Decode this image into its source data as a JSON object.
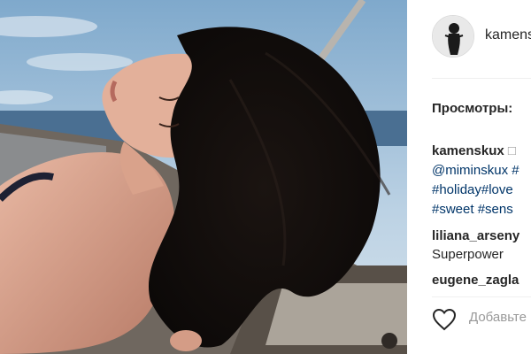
{
  "post": {
    "username": "kamenskux",
    "views_label": "Просмотры:",
    "caption": {
      "username": "kamenskux",
      "box_glyph": "□",
      "lines": [
        "@miminskux #",
        "#holiday#love",
        "#sweet #sens"
      ]
    },
    "comments": [
      {
        "user": "liliana_arseny",
        "text": "Superpower"
      },
      {
        "user": "eugene_zagla",
        "text": ""
      }
    ],
    "add_comment_placeholder": "Добавьте",
    "icons": {
      "like": "heart-icon"
    },
    "colors": {
      "hashtag": "#003569",
      "text": "#262626",
      "muted": "#999999"
    }
  }
}
